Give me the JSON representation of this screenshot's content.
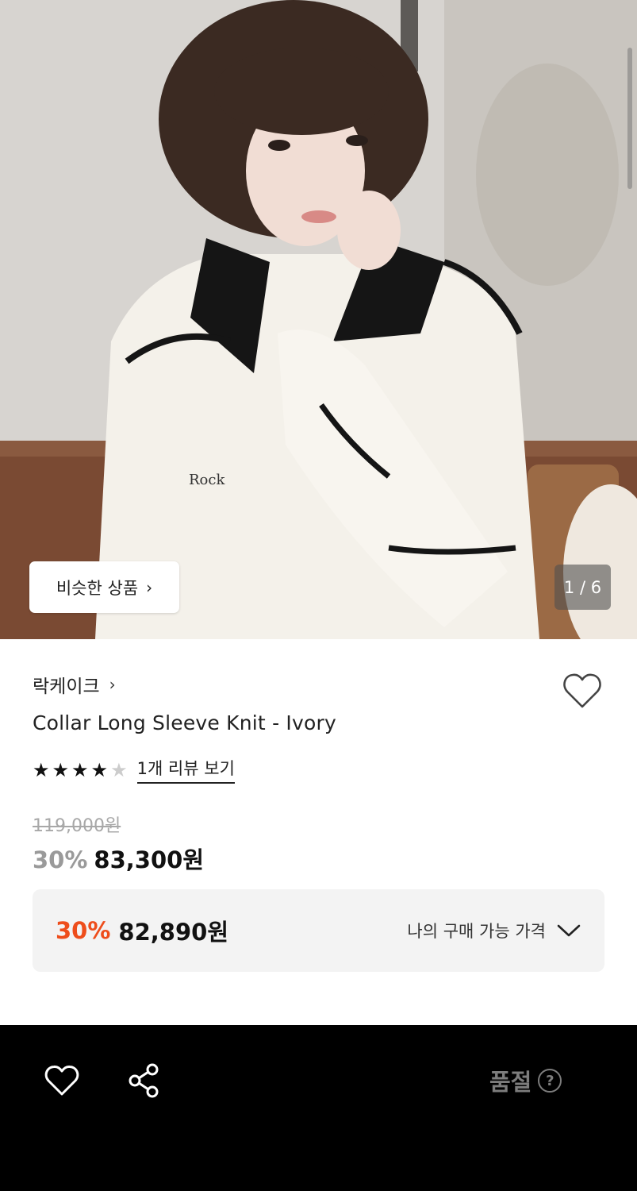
{
  "gallery": {
    "similar_button_label": "비슷한 상품",
    "counter": "1 / 6"
  },
  "product": {
    "brand": "락케이크",
    "title": "Collar Long Sleeve Knit - Ivory",
    "rating": 4,
    "rating_max": 5,
    "review_link": "1개 리뷰 보기",
    "original_price": "119,000원",
    "discount_rate": "30%",
    "sale_price": "83,300원"
  },
  "my_price": {
    "discount_rate": "30%",
    "price": "82,890원",
    "label": "나의 구매 가능 가격"
  },
  "bottom_bar": {
    "status_label": "품절",
    "help_glyph": "?"
  },
  "colors": {
    "accent": "#ee4d1b",
    "bottom_bar_bg": "#000000",
    "muted_text": "#9a9a9a"
  }
}
